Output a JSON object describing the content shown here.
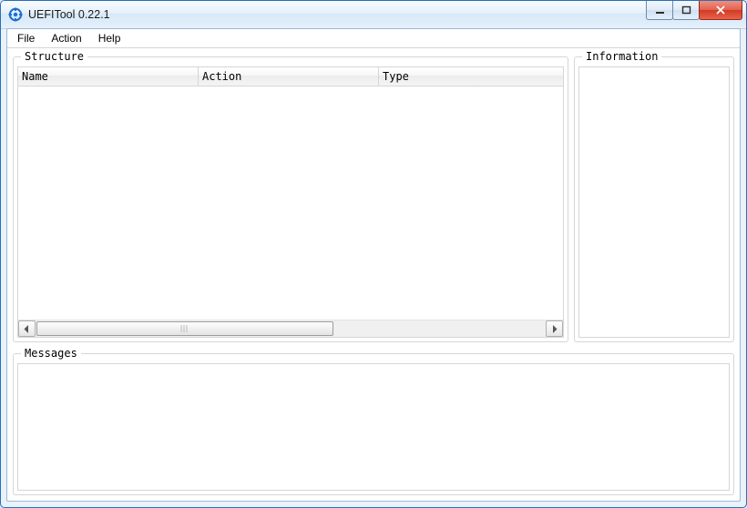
{
  "window": {
    "title": "UEFITool 0.22.1"
  },
  "menubar": {
    "file": "File",
    "action": "Action",
    "help": "Help"
  },
  "panels": {
    "structure": {
      "title": "Structure",
      "columns": {
        "name": "Name",
        "action": "Action",
        "type": "Type"
      }
    },
    "information": {
      "title": "Information"
    },
    "messages": {
      "title": "Messages"
    }
  }
}
